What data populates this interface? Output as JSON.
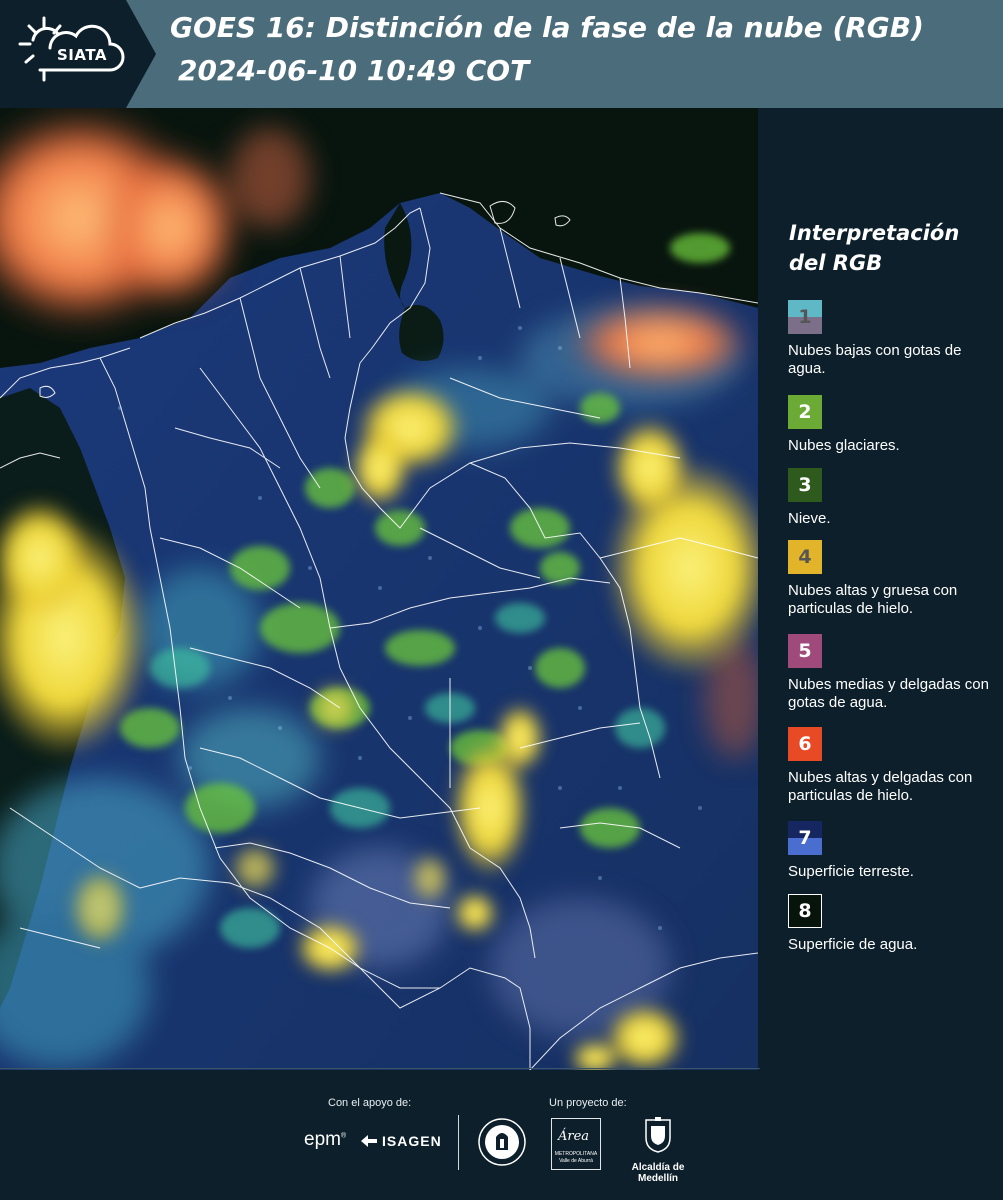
{
  "header": {
    "brand": "SIATA",
    "title": "GOES 16: Distinción de la fase de la nube (RGB)",
    "timestamp": "2024-06-10 10:49 COT",
    "background_color": "#4b6c7a"
  },
  "legend": {
    "title_line1": "Interpretación",
    "title_line2": "del RGB",
    "items": [
      {
        "num": "1",
        "label": "Nubes bajas con gotas de agua.",
        "colors": [
          "#5fb8c6",
          "#7c6f8a"
        ],
        "num_color": "#555555"
      },
      {
        "num": "2",
        "label": "Nubes glaciares.",
        "colors": [
          "#6aaa35"
        ],
        "num_color": "#ffffff"
      },
      {
        "num": "3",
        "label": "Nieve.",
        "colors": [
          "#2f5a1d"
        ],
        "num_color": "#ffffff"
      },
      {
        "num": "4",
        "label": "Nubes altas y gruesa con particulas de hielo.",
        "colors": [
          "#e2b42a"
        ],
        "num_color": "#555555"
      },
      {
        "num": "5",
        "label": "Nubes medias y delgadas con gotas de agua.",
        "colors": [
          "#a04a7c"
        ],
        "num_color": "#ffffff"
      },
      {
        "num": "6",
        "label": "Nubes altas y delgadas con particulas de hielo.",
        "colors": [
          "#e84a26"
        ],
        "num_color": "#ffffff"
      },
      {
        "num": "7",
        "label": "Superficie terreste.",
        "colors": [
          "#152660",
          "#4a6ed0"
        ],
        "num_color": "#ffffff"
      },
      {
        "num": "8",
        "label": "Superficie de agua.",
        "colors": [
          "#07140c"
        ],
        "num_color": "#ffffff"
      }
    ]
  },
  "footer": {
    "support_label": "Con el apoyo de:",
    "project_label": "Un proyecto de:",
    "epm": "epm",
    "isagen": "ISAGEN",
    "area_title": "Área",
    "area_sub1": "METROPOLITANA",
    "area_sub2": "Valle de Aburrá",
    "alcaldia": "Alcaldía de Medellín"
  },
  "colors": {
    "page_background": "#0c1f2a",
    "land_surface": "#1a3a7a",
    "water_surface": "#07140c",
    "thick_ice_cloud": "#f2e23a",
    "thin_ice_cloud": "#e8643a",
    "glaciated_cloud": "#7fcf3f",
    "low_water_cloud": "#5fb8c6",
    "boundaries": "#ffffff"
  }
}
